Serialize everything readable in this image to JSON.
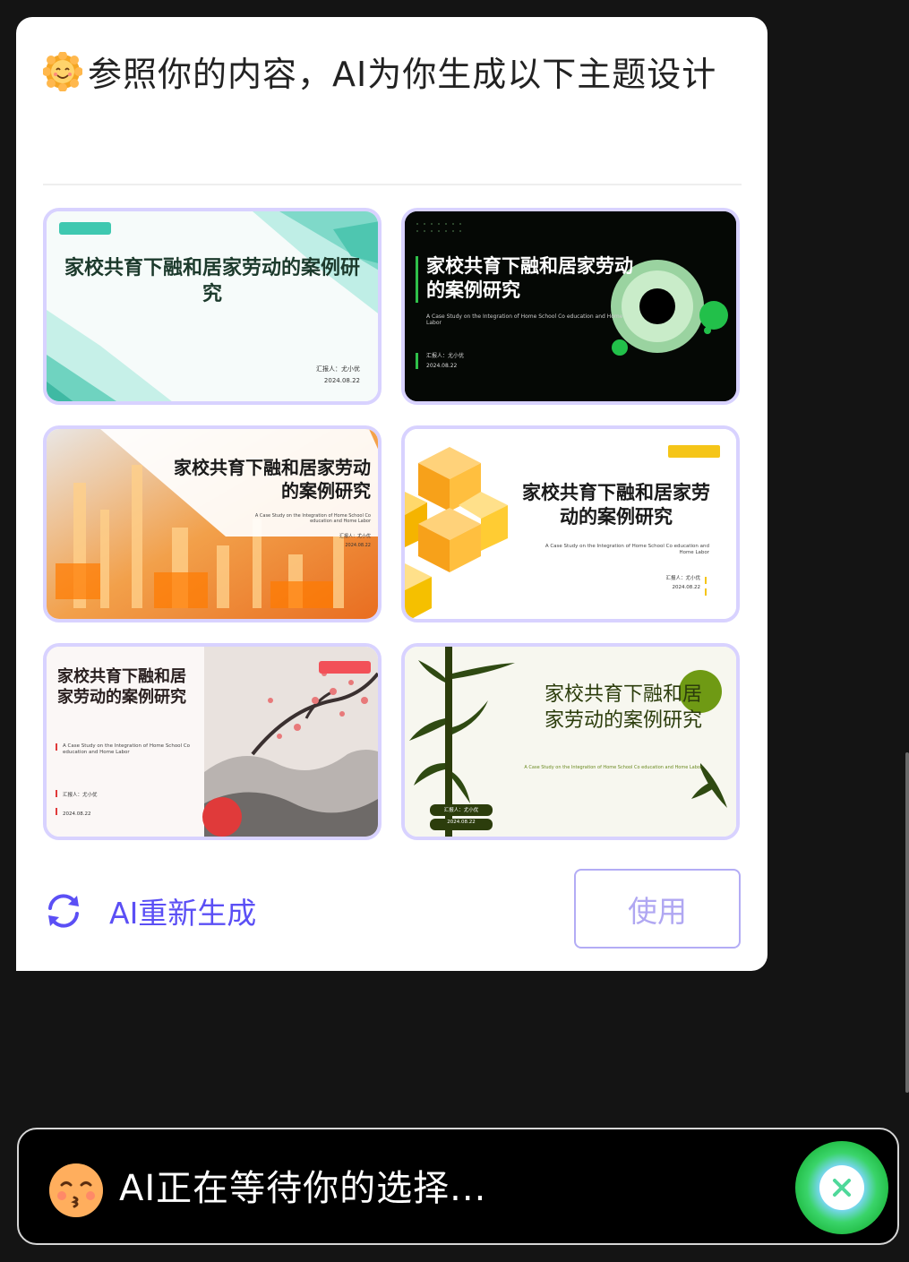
{
  "dialog": {
    "title": "参照你的内容，AI为你生成以下主题设计"
  },
  "themes": [
    {
      "title": "家校共育下融和居家劳动的案例研究",
      "reporter": "汇报人：尤小优",
      "date": "2024.08.22"
    },
    {
      "title": "家校共育下融和居家劳动的案例研究",
      "subtitle": "A Case Study on the Integration of Home School Co education and Home Labor",
      "reporter": "汇报人：尤小优",
      "date": "2024.08.22"
    },
    {
      "title": "家校共育下融和居家劳动的案例研究",
      "subtitle": "A Case Study on the Integration of Home School Co education and Home Labor",
      "reporter": "汇报人：尤小优",
      "date": "2024.08.22"
    },
    {
      "title": "家校共育下融和居家劳动的案例研究",
      "subtitle": "A Case Study on the Integration of Home School Co education and Home Labor",
      "reporter": "汇报人：尤小优",
      "date": "2024.08.22"
    },
    {
      "title": "家校共育下融和居家劳动的案例研究",
      "subtitle": "A Case Study on the Integration of Home School Co education and Home Labor",
      "reporter": "汇报人：尤小优",
      "date": "2024.08.22"
    },
    {
      "title": "家校共育下融和居家劳动的案例研究",
      "subtitle": "A Case Study on the Integration of Home School Co education and Home Labor",
      "reporter": "汇报人：尤小优",
      "date": "2024.08.22"
    }
  ],
  "actions": {
    "regenerate_label": "AI重新生成",
    "use_label": "使用"
  },
  "status": {
    "text": "AI正在等待你的选择..."
  },
  "colors": {
    "accent": "#5b4ff5",
    "thumb_border": "#d8d2ff",
    "use_border": "#b3acf5"
  }
}
